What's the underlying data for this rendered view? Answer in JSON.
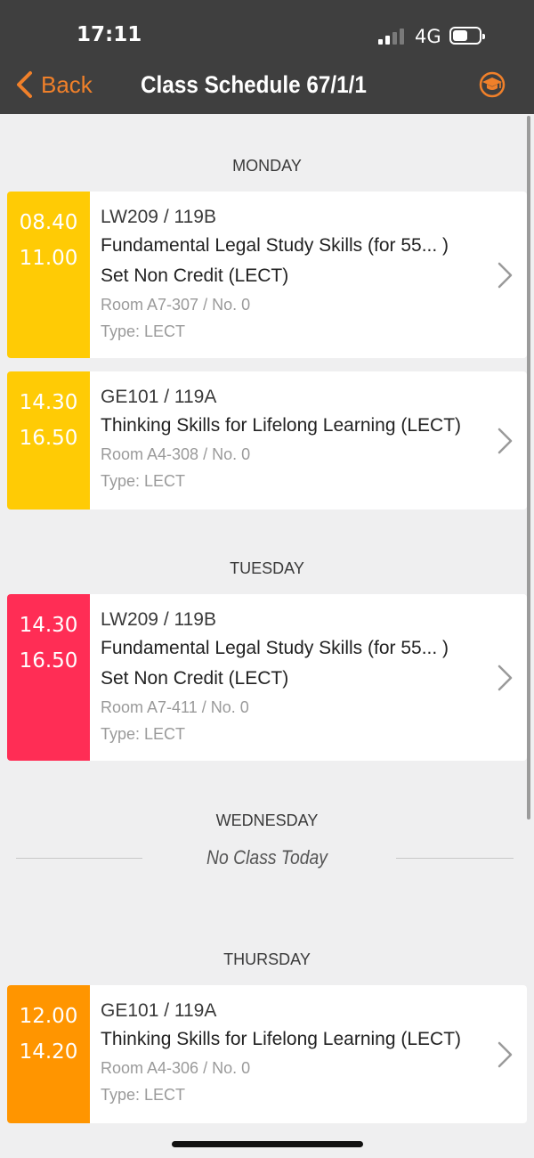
{
  "status_bar": {
    "time": "17:11",
    "network": "4G"
  },
  "nav": {
    "back_label": "Back",
    "title": "Class Schedule 67/1/1"
  },
  "days": {
    "monday": "MONDAY",
    "tuesday": "TUESDAY",
    "wednesday": "WEDNESDAY",
    "thursday": "THURSDAY"
  },
  "no_class_text": "No Class Today",
  "classes": [
    {
      "start": "08.40",
      "end": "11.00",
      "code": "LW209   / 119B",
      "title_lines": [
        "Fundamental Legal Study Skills (for 55... )",
        "Set Non Credit (LECT)"
      ],
      "room": "Room A7-307 / No. 0",
      "type": "Type: LECT",
      "color": "#ffcb05"
    },
    {
      "start": "14.30",
      "end": "16.50",
      "code": "GE101   / 119A",
      "title_lines": [
        "Thinking Skills for Lifelong Learning (LECT)"
      ],
      "room": "Room A4-308 / No. 0",
      "type": "Type: LECT",
      "color": "#ffcb05"
    },
    {
      "start": "14.30",
      "end": "16.50",
      "code": "LW209   / 119B",
      "title_lines": [
        "Fundamental Legal Study Skills (for 55... )",
        "Set Non Credit (LECT)"
      ],
      "room": "Room A7-411 / No. 0",
      "type": "Type: LECT",
      "color": "#ff2d55"
    },
    {
      "start": "12.00",
      "end": "14.20",
      "code": "GE101   / 119A",
      "title_lines": [
        "Thinking Skills for Lifelong Learning (LECT)"
      ],
      "room": "Room A4-306 / No. 0",
      "type": "Type: LECT",
      "color": "#ff9500"
    }
  ],
  "colors": {
    "accent": "#f0802a",
    "header_bg": "#3f3f3f",
    "page_bg": "#efeff0"
  },
  "icons": {
    "back": "chevron-left-icon",
    "graduation": "graduation-cap-icon",
    "disclosure": "chevron-right-icon"
  }
}
